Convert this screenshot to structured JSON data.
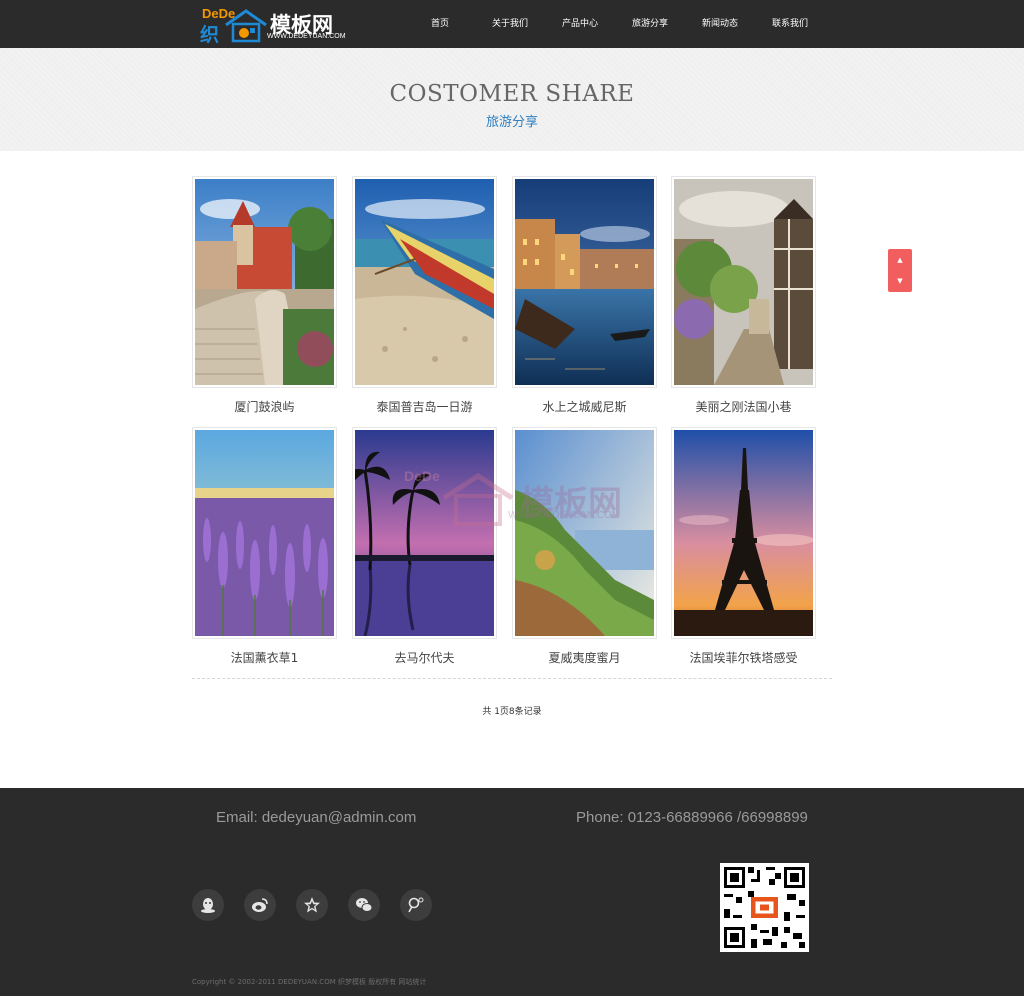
{
  "header": {
    "logo": {
      "dede": "DeDe",
      "zhi": "织",
      "mb": "模板网",
      "url": "WWW.DEDEYUAN.COM"
    },
    "nav": [
      "首页",
      "关于我们",
      "产品中心",
      "旅游分享",
      "新闻动态",
      "联系我们"
    ]
  },
  "banner": {
    "title_en": "COSTOMER SHARE",
    "title_cn": "旅游分享"
  },
  "gallery": {
    "items": [
      {
        "caption": "厦门鼓浪屿",
        "icon": "coastal-villa-photo"
      },
      {
        "caption": "泰国普吉岛一日游",
        "icon": "beach-boat-photo"
      },
      {
        "caption": "水上之城威尼斯",
        "icon": "venice-canal-photo"
      },
      {
        "caption": "美丽之刚法国小巷",
        "icon": "french-alley-photo"
      },
      {
        "caption": "法国薰衣草1",
        "icon": "lavender-field-photo"
      },
      {
        "caption": "去马尔代夫",
        "icon": "maldives-palms-photo"
      },
      {
        "caption": "夏威夷度蜜月",
        "icon": "hawaii-coast-photo"
      },
      {
        "caption": "法国埃菲尔铁塔感受",
        "icon": "eiffel-tower-photo"
      }
    ]
  },
  "pager": {
    "text": "共 1页8条记录"
  },
  "watermark": {
    "dede": "DeDe",
    "text": "模板网",
    "url": "WWW.DEDEYUAN.COM"
  },
  "footer": {
    "email": "Email: dedeyuan@admin.com",
    "phone": "Phone: 0123-66889966 /66998899",
    "socials": [
      "qq-icon",
      "weibo-icon",
      "star-icon",
      "wechat-icon",
      "search-people-icon"
    ],
    "copyright": "Copyright © 2002-2011 DEDEYUAN.COM 织梦模板 版权所有 网站统计"
  },
  "colors": {
    "header_bg": "#2b2b2b",
    "accent_blue": "#2f7fc1",
    "scroll_red": "#f25d5d"
  }
}
